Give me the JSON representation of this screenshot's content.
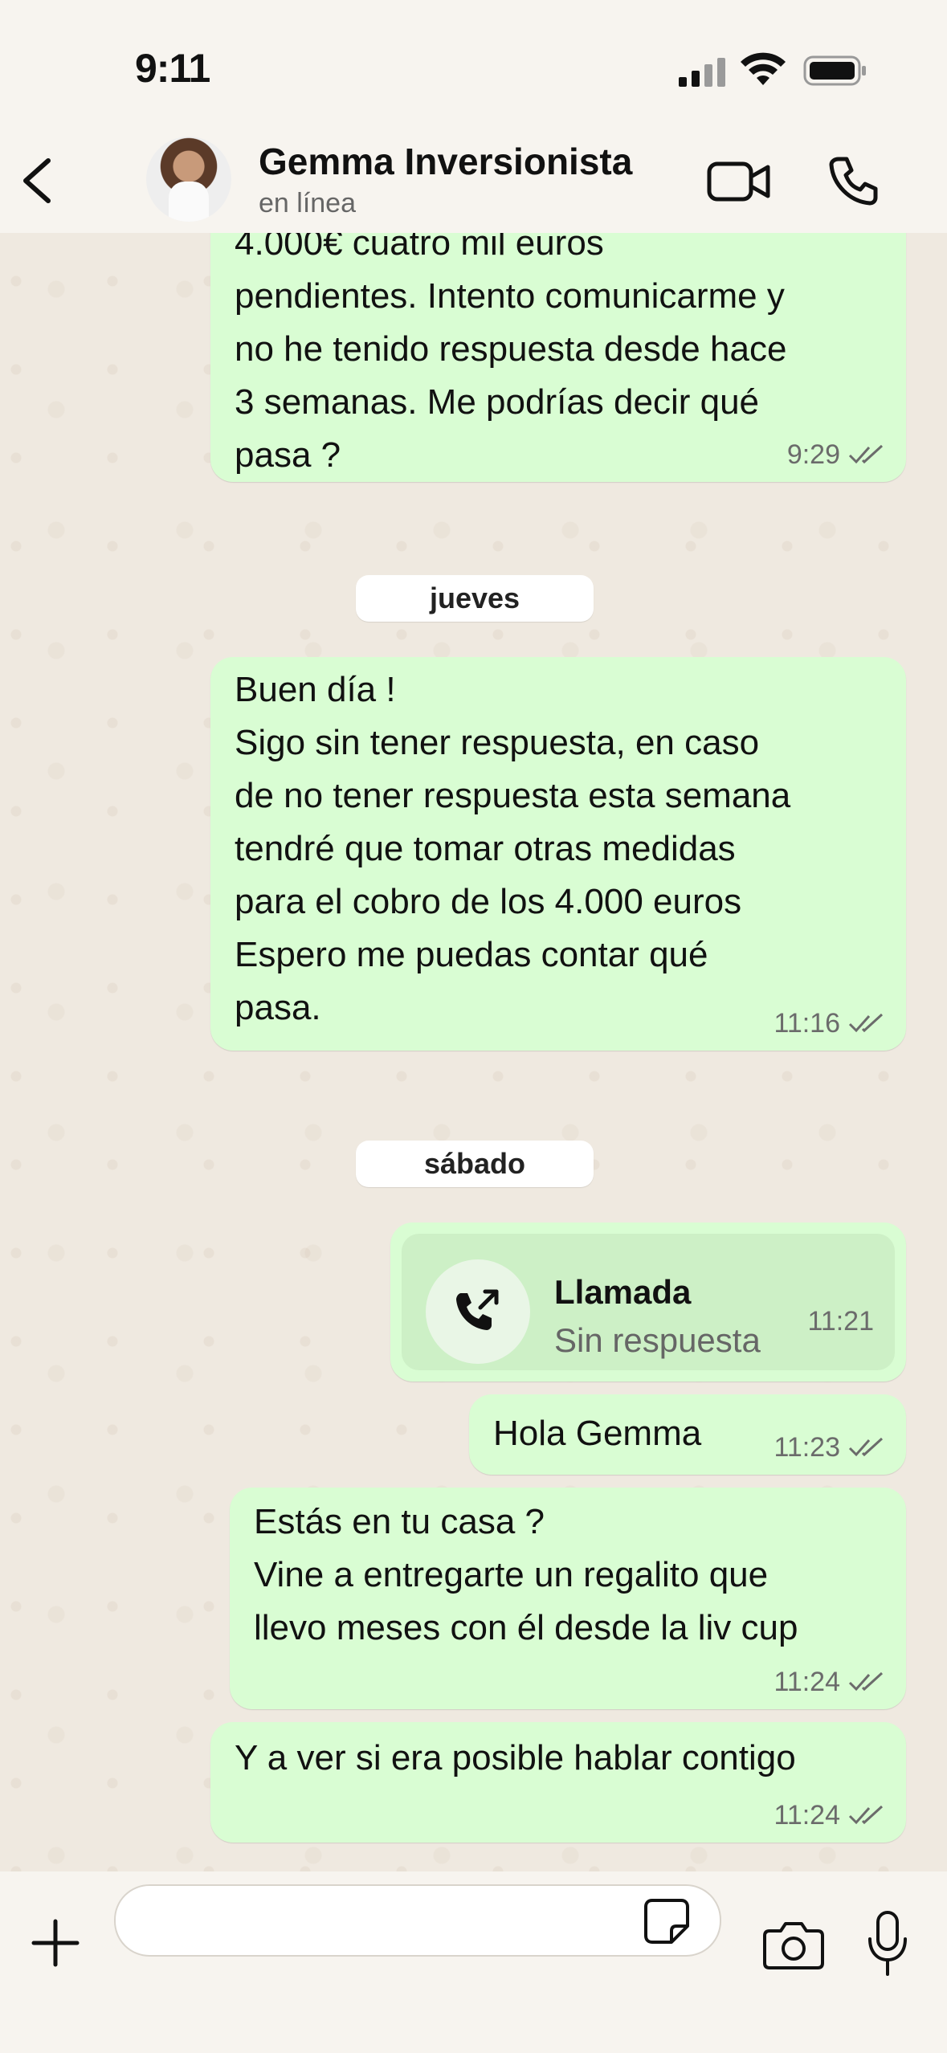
{
  "status_bar": {
    "time": "9:11"
  },
  "header": {
    "contact_name": "Gemma Inversionista",
    "contact_status": "en línea"
  },
  "messages": [
    {
      "text": "4.000€ cuatro mil euros\npendientes. Intento comunicarme y\nno he tenido respuesta desde hace\n3 semanas. Me podrías decir qué\npasa ?",
      "time": "9:29"
    },
    {
      "text": "Buen día !\nSigo sin tener respuesta, en caso\nde no tener respuesta esta semana\ntendré que tomar otras medidas\npara el cobro de los 4.000 euros\nEspero me puedas contar qué\npasa.",
      "time": "11:16"
    },
    {
      "text": "Hola Gemma",
      "time": "11:23"
    },
    {
      "text": "Estás en tu casa ?\nVine a entregarte un regalito que\nllevo meses con él desde la liv cup",
      "time": "11:24"
    },
    {
      "text": "Y a ver si era posible hablar contigo",
      "time": "11:24"
    }
  ],
  "date_separators": [
    "jueves",
    "sábado"
  ],
  "call": {
    "title": "Llamada",
    "subtitle": "Sin respuesta",
    "time": "11:21"
  },
  "colors": {
    "outgoing_bubble": "#d9fdd3",
    "tick": "#6b6b6b",
    "background": "#efe9e0"
  },
  "icons": [
    "back-arrow-icon",
    "video-call-icon",
    "phone-icon",
    "double-check-icon",
    "outgoing-call-icon",
    "plus-icon",
    "sticker-icon",
    "camera-icon",
    "microphone-icon",
    "signal-icon",
    "wifi-icon",
    "battery-icon"
  ]
}
